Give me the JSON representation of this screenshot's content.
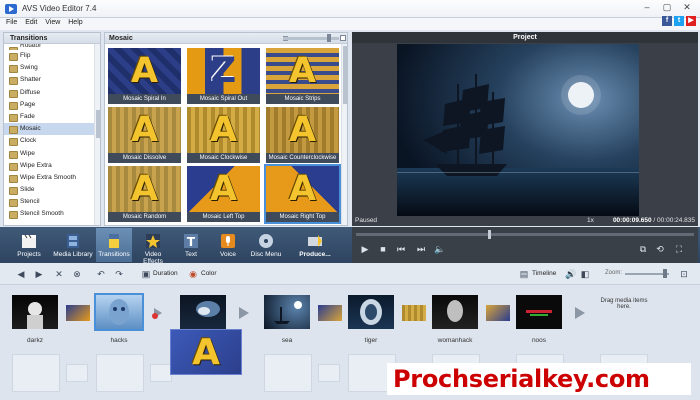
{
  "window": {
    "title": "AVS Video Editor 7.4"
  },
  "menu": [
    "File",
    "Edit",
    "View",
    "Help"
  ],
  "transitions_panel": {
    "title": "Transitions",
    "items": [
      "Rotator",
      "Flip",
      "Swing",
      "Shatter",
      "Diffuse",
      "Page",
      "Fade",
      "Mosaic",
      "Clock",
      "Wipe",
      "Wipe Extra",
      "Wipe Extra Smooth",
      "Slide",
      "Stencil",
      "Stencil Smooth"
    ],
    "selected": "Mosaic"
  },
  "mosaic_panel": {
    "title": "Mosaic",
    "thumbnails": [
      {
        "label": "Mosaic Spiral In",
        "letter": "A"
      },
      {
        "label": "Mosaic Spiral Out",
        "letter": "Z"
      },
      {
        "label": "Mosaic Strips",
        "letter": "A"
      },
      {
        "label": "Mosaic Dissolve",
        "letter": "A"
      },
      {
        "label": "Mosaic Clockwise",
        "letter": "A"
      },
      {
        "label": "Mosaic Counterclockwise",
        "letter": "A"
      },
      {
        "label": "Mosaic Random",
        "letter": "A"
      },
      {
        "label": "Mosaic Left Top",
        "letter": "A"
      },
      {
        "label": "Mosaic Right Top",
        "letter": "A"
      }
    ]
  },
  "preview": {
    "title": "Project",
    "status": "Paused",
    "speed": "1x",
    "current_time": "00:00:09.650",
    "separator": "/",
    "total_time": "00:00:24.835"
  },
  "toolbar": {
    "items": [
      "Projects",
      "Media Library",
      "Transitions",
      "Video Effects",
      "Text",
      "Voice",
      "Disc Menu",
      "Produce..."
    ],
    "active": "Transitions"
  },
  "timeline_toolbar": {
    "duration_label": "Duration",
    "color_label": "Color",
    "timeline_label": "Timeline",
    "zoom_label": "Zoom:"
  },
  "storyboard": {
    "clips": [
      "darkz",
      "hacks",
      "sea",
      "tiger",
      "womanhack",
      "noos"
    ],
    "drag_hint": "Drag media items here."
  },
  "watermark": "Prochserialkey.com",
  "colors": {
    "toolbar": "#2e4460",
    "selection": "#4a90d9",
    "watermark": "#cc0000"
  }
}
